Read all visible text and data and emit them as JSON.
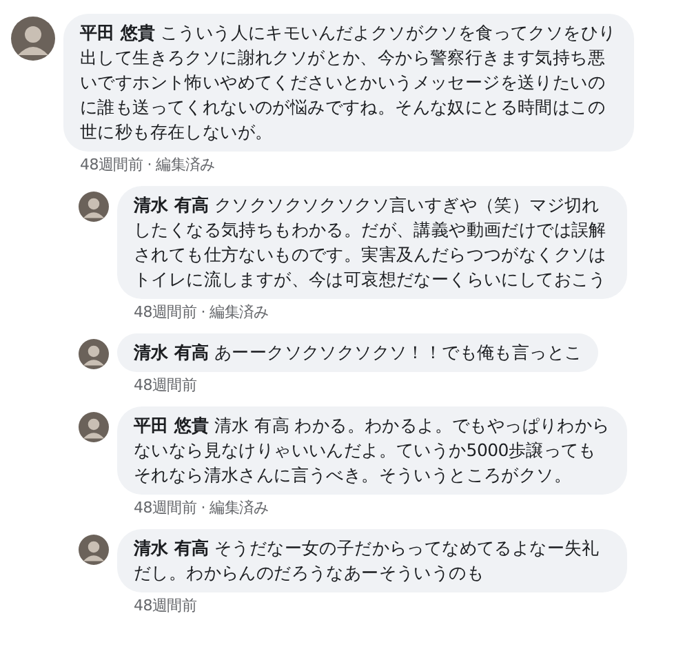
{
  "comments": [
    {
      "author": "平田 悠貴",
      "text": "こういう人にキモいんだよクソがクソを食ってクソをひり出して生きろクソに謝れクソがとか、今から警察行きます気持ち悪いですホント怖いやめてくださいとかいうメッセージを送りたいのに誰も送ってくれないのが悩みですね。そんな奴にとる時間はこの世に秒も存在しないが。",
      "meta": "48週間前 · 編集済み",
      "replies": [
        {
          "author": "清水 有高",
          "text": "クソクソクソクソクソ言いすぎや（笑）マジ切れしたくなる気持ちもわかる。だが、講義や動画だけでは誤解されても仕方ないものです。実害及んだらつつがなくクソはトイレに流しますが、今は可哀想だなーくらいにしておこう",
          "meta": "48週間前 · 編集済み"
        },
        {
          "author": "清水 有高",
          "text": "あーークソクソクソクソ！！でも俺も言っとこ",
          "meta": "48週間前"
        },
        {
          "author": "平田 悠貴",
          "text": "清水 有高 わかる。わかるよ。でもやっぱりわからないなら見なけりゃいいんだよ。ていうか5000歩譲ってもそれなら清水さんに言うべき。そういうところがクソ。",
          "meta": "48週間前 · 編集済み"
        },
        {
          "author": "清水 有高",
          "text": "そうだなー女の子だからってなめてるよなー失礼だし。わからんのだろうなあーそういうのも",
          "meta": "48週間前"
        }
      ]
    }
  ]
}
